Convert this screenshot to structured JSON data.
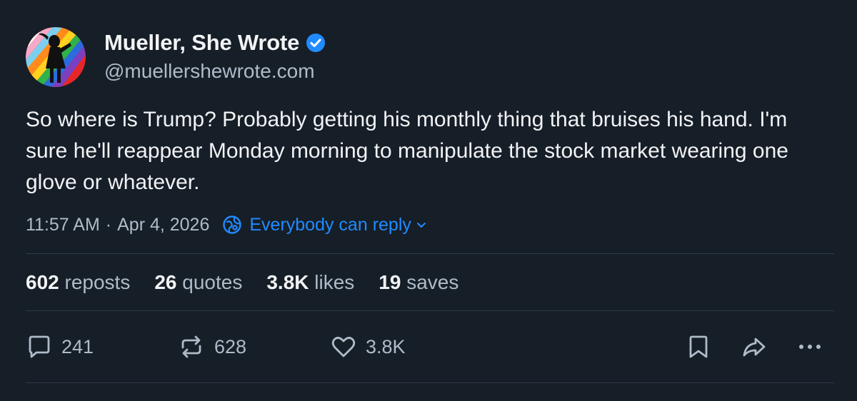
{
  "author": {
    "display_name": "Mueller, She Wrote",
    "handle": "@muellershewrote.com",
    "verified": true,
    "avatar_icon": "rainbow-silhouette-avatar"
  },
  "post": {
    "text": "So where is Trump? Probably getting his monthly thing that bruises his hand. I'm sure he'll reappear Monday morning to manipulate the stock market wearing one glove or whatever.",
    "time": "11:57 AM",
    "separator": "·",
    "date": "Apr 4, 2026",
    "reply_setting": "Everybody can reply"
  },
  "stats": {
    "reposts_count": "602",
    "reposts_label": "reposts",
    "quotes_count": "26",
    "quotes_label": "quotes",
    "likes_count": "3.8K",
    "likes_label": "likes",
    "saves_count": "19",
    "saves_label": "saves"
  },
  "actions": {
    "reply_count": "241",
    "repost_count": "628",
    "like_count": "3.8K"
  },
  "colors": {
    "background": "#161e27",
    "text": "#f1f3f5",
    "muted": "#aebbc9",
    "accent": "#208bfe",
    "divider": "#2e3b4a"
  }
}
